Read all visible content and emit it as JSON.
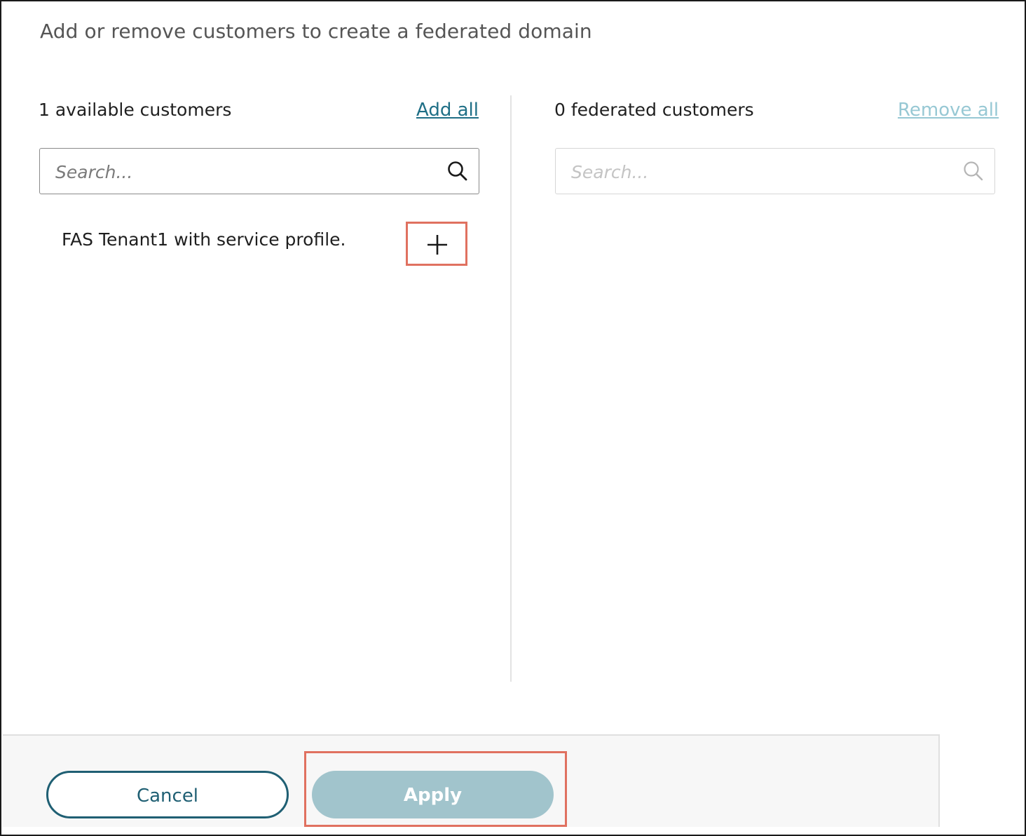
{
  "dialog": {
    "title": "Add or remove customers to create a federated domain"
  },
  "available": {
    "heading": "1 available customers",
    "add_all_label": "Add all",
    "search_placeholder": "Search...",
    "items": [
      {
        "label": "FAS Tenant1 with service profile."
      }
    ]
  },
  "federated": {
    "heading": "0 federated customers",
    "remove_all_label": "Remove all",
    "search_placeholder": "Search..."
  },
  "footer": {
    "cancel_label": "Cancel",
    "apply_label": "Apply"
  },
  "colors": {
    "accent": "#1f6f86",
    "highlight": "#e07160",
    "apply_disabled": "#a1c4cc"
  }
}
